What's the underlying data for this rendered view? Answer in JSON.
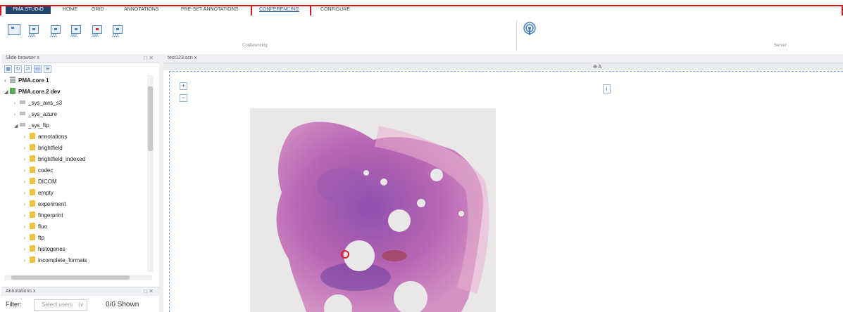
{
  "app": {
    "brand": "PMA.STUDIO",
    "tabs": [
      "HOME",
      "GRID",
      "ANNOTATIONS",
      "PRE-SET ANNOTATIONS",
      "CONFERENCING",
      "CONFIGURE"
    ],
    "active_tab": "CONFERENCING"
  },
  "ribbon": {
    "group_conferencing": "Conferencing",
    "group_server": "Server"
  },
  "slide_browser": {
    "tab_title": "Slide browser",
    "tab_close": "x",
    "panel_controls": "□ ✕",
    "tree": [
      {
        "label": "PMA.core 1",
        "level": 0,
        "arrow": "›",
        "icon": "server-icon",
        "bold": true
      },
      {
        "label": "PMA.core.2 dev",
        "level": 0,
        "arrow": "◢",
        "icon": "server-green-icon",
        "bold": true
      },
      {
        "label": "_sys_aws_s3",
        "level": 1,
        "arrow": "›",
        "icon": "drive-icon"
      },
      {
        "label": "_sys_azure",
        "level": 1,
        "arrow": "›",
        "icon": "drive-icon"
      },
      {
        "label": "_sys_ftp",
        "level": 1,
        "arrow": "◢",
        "icon": "drive-icon"
      },
      {
        "label": "annotations",
        "level": 2,
        "arrow": "›",
        "icon": "folder-icon"
      },
      {
        "label": "brightfield",
        "level": 2,
        "arrow": "›",
        "icon": "folder-icon"
      },
      {
        "label": "brightfield_indexed",
        "level": 2,
        "arrow": "›",
        "icon": "folder-icon"
      },
      {
        "label": "codec",
        "level": 2,
        "arrow": "›",
        "icon": "folder-icon"
      },
      {
        "label": "DICOM",
        "level": 2,
        "arrow": "›",
        "icon": "folder-icon"
      },
      {
        "label": "empty",
        "level": 2,
        "arrow": "›",
        "icon": "folder-icon"
      },
      {
        "label": "experiment",
        "level": 2,
        "arrow": "›",
        "icon": "folder-icon"
      },
      {
        "label": "fingerprint",
        "level": 2,
        "arrow": "›",
        "icon": "folder-icon"
      },
      {
        "label": "fluo",
        "level": 2,
        "arrow": "›",
        "icon": "folder-icon"
      },
      {
        "label": "ftp",
        "level": 2,
        "arrow": "›",
        "icon": "folder-icon"
      },
      {
        "label": "histogenes",
        "level": 2,
        "arrow": "›",
        "icon": "folder-icon"
      },
      {
        "label": "incomplete_formats",
        "level": 2,
        "arrow": "›",
        "icon": "folder-icon"
      }
    ]
  },
  "annotations_panel": {
    "tab_title": "Annotations",
    "tab_close": "x",
    "panel_controls": "□ ✕",
    "filter_label": "Filter:",
    "select_placeholder": "Select users",
    "shown_text": "0/0 Shown"
  },
  "viewer": {
    "tab_title": "test123.scn",
    "tab_close": "x",
    "header_label": "⊕ A",
    "zoom_in": "+",
    "zoom_out": "−",
    "info": "i"
  },
  "colors": {
    "brand": "#23466e",
    "highlight_frame": "#d71920",
    "accent": "#2a5ba8",
    "tissue": "#b05aa8"
  }
}
